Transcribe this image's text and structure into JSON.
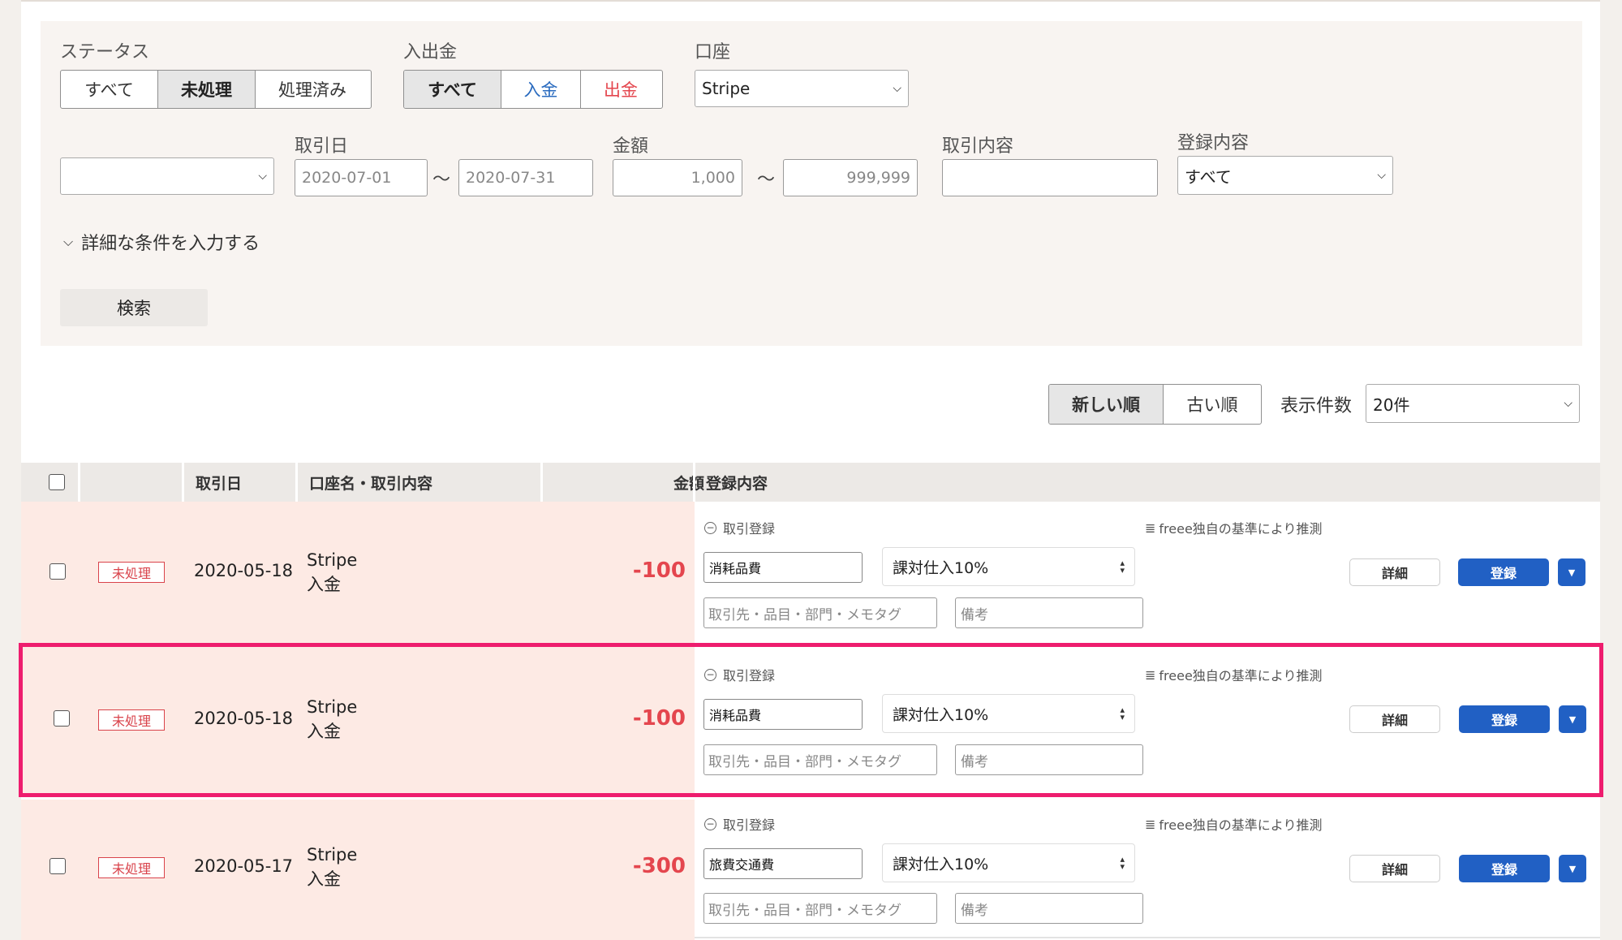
{
  "filters": {
    "status": {
      "label": "ステータス",
      "options": [
        "すべて",
        "未処理",
        "処理済み"
      ],
      "selected": "未処理"
    },
    "direction": {
      "label": "入出金",
      "options": [
        "すべて",
        "入金",
        "出金"
      ],
      "selected": "すべて",
      "colors": {
        "入金": "#2a6bbf",
        "出金": "#e4464e"
      }
    },
    "account": {
      "label": "口座",
      "value": "Stripe"
    },
    "date_kind": {
      "value": ""
    },
    "date": {
      "label": "取引日",
      "from": "2020-07-01",
      "to": "2020-07-31",
      "separator": "〜"
    },
    "amount": {
      "label": "金額",
      "min": "1,000",
      "max": "999,999",
      "separator": "〜"
    },
    "description": {
      "label": "取引内容",
      "value": ""
    },
    "registration": {
      "label": "登録内容",
      "value": "すべて"
    },
    "more_toggle": "詳細な条件を入力する",
    "search_label": "検索"
  },
  "sort": {
    "options": [
      "新しい順",
      "古い順"
    ],
    "selected": "新しい順",
    "per_page_label": "表示件数",
    "per_page_value": "20件"
  },
  "table": {
    "headers": {
      "date": "取引日",
      "account": "口座名・取引内容",
      "amount": "金額",
      "registration": "登録内容"
    },
    "rows": [
      {
        "status": "未処理",
        "date": "2020-05-18",
        "account": "Stripe",
        "kind": "入金",
        "amount": "-100",
        "reg_title": "取引登録",
        "guess": "freee独自の基準により推測",
        "account_item": "消耗品費",
        "tax": "課対仕入10%",
        "tags_placeholder": "取引先・品目・部門・メモタグ",
        "memo_placeholder": "備考",
        "detail_label": "詳細",
        "register_label": "登録"
      },
      {
        "status": "未処理",
        "date": "2020-05-18",
        "account": "Stripe",
        "kind": "入金",
        "amount": "-100",
        "reg_title": "取引登録",
        "guess": "freee独自の基準により推測",
        "account_item": "消耗品費",
        "tax": "課対仕入10%",
        "tags_placeholder": "取引先・品目・部門・メモタグ",
        "memo_placeholder": "備考",
        "detail_label": "詳細",
        "register_label": "登録"
      },
      {
        "status": "未処理",
        "date": "2020-05-17",
        "account": "Stripe",
        "kind": "入金",
        "amount": "-300",
        "reg_title": "取引登録",
        "guess": "freee独自の基準により推測",
        "account_item": "旅費交通費",
        "tax": "課対仕入10%",
        "tags_placeholder": "取引先・品目・部門・メモタグ",
        "memo_placeholder": "備考",
        "detail_label": "詳細",
        "register_label": "登録"
      }
    ]
  },
  "colors": {
    "accent": "#2160c4",
    "negative": "#e4464e",
    "highlight": "#ee1d6e",
    "row_bg": "#fdeae4"
  }
}
